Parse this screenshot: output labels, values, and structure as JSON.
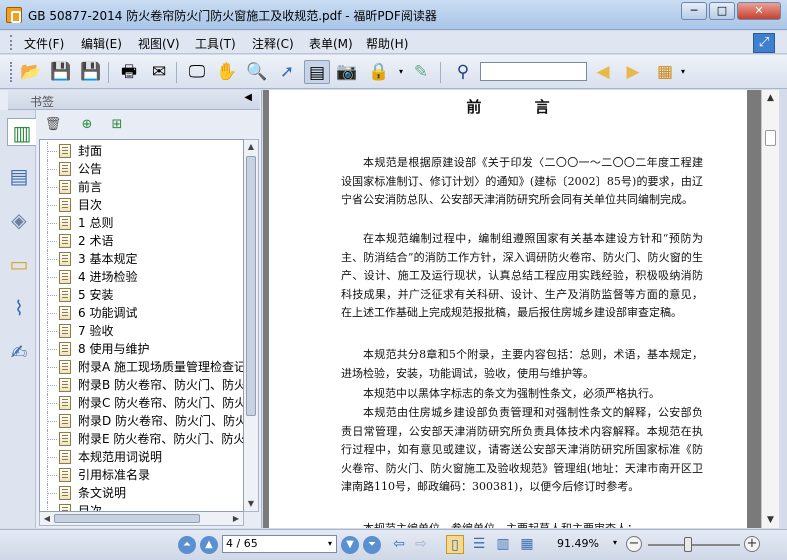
{
  "window": {
    "title": "GB 50877-2014 防火卷帘防火门防火窗施工及收规范.pdf - 福昕PDF阅读器",
    "minimize": "─",
    "maximize": "□",
    "close": "✕"
  },
  "menu": [
    "文件(F)",
    "编辑(E)",
    "视图(V)",
    "工具(T)",
    "注释(C)",
    "表单(M)",
    "帮助(H)"
  ],
  "toolbar": {
    "icons": [
      "open-folder",
      "save",
      "save-as",
      "print",
      "email",
      "screen",
      "hand",
      "zoom",
      "select",
      "text-select",
      "snapshot",
      "rms",
      "stamp",
      "binoculars",
      "find-prev",
      "find-next",
      "highlight"
    ],
    "search_value": ""
  },
  "bookmarks": {
    "title": "书签",
    "items": [
      "封面",
      "公告",
      "前言",
      "目次",
      "1 总则",
      "2 术语",
      "3 基本规定",
      "4 进场检验",
      "5 安装",
      "6 功能调试",
      "7 验收",
      "8 使用与维护",
      "附录A 施工现场质量管理检查记录",
      "附录B 防火卷帘、防火门、防火窗",
      "附录C 防火卷帘、防火门、防火窗",
      "附录D 防火卷帘、防火门、防火窗",
      "附录E 防火卷帘、防火门、防火窗",
      "本规范用词说明",
      "引用标准名录",
      "条文说明",
      "目次"
    ]
  },
  "document": {
    "heading": "前 言",
    "paragraphs": [
      "本规范是根据原建设部《关于印发〈二〇〇一～二〇〇二年度工程建设国家标准制订、修订计划〉的通知》(建标〔2002〕85号)的要求，由辽宁省公安消防总队、公安部天津消防研究所会同有关单位共同编制完成。",
      "在本规范编制过程中，编制组遵照国家有关基本建设方针和“预防为主、防消结合”的消防工作方针，深入调研防火卷帘、防火门、防火窗的生产、设计、施工及运行现状，认真总结工程应用实践经验，积极吸纳消防科技成果，并广泛征求有关科研、设计、生产及消防监督等方面的意见，在上述工作基础上完成规范报批稿，最后报住房城乡建设部审查定稿。",
      "本规范共分8章和5个附录，主要内容包括：总则，术语，基本规定，进场检验，安装，功能调试，验收，使用与维护等。",
      "本规范中以黑体字标志的条文为强制性条文，必须严格执行。",
      "本规范由住房城乡建设部负责管理和对强制性条文的解释，公安部负责日常管理，公安部天津消防研究所负责具体技术内容解释。本规范在执行过程中，如有意见或建议，请寄送公安部天津消防研究所国家标准《防火卷帘、防火门、防火窗施工及验收规范》管理组(地址：天津市南开区卫津南路110号，邮政编码：300381)，以便今后修订时参考。",
      "本规范主编单位、参编单位、主要起草人和主要审查人："
    ]
  },
  "status": {
    "page": "4 / 65",
    "zoom": "91.49%"
  },
  "colors": {
    "accent": "#3f7fcf",
    "page_bg": "#7a7a7a"
  }
}
